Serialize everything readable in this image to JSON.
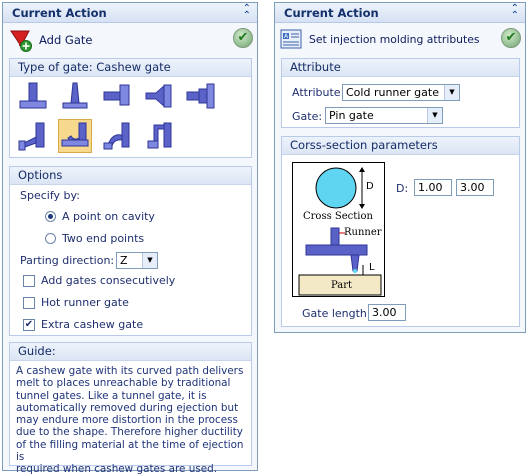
{
  "left_panel": {
    "title": "Current Action",
    "action_label": "Add Gate",
    "gate_type": {
      "heading": "Type of gate: Cashew gate",
      "buttons": [
        "direct-gate-icon",
        "pin-gate-icon",
        "side-gate-icon",
        "fan-gate-icon",
        "tab-gate-icon",
        "submarine-gate-icon",
        "cashew-gate-icon",
        "banana-gate-icon",
        "hook-gate-icon"
      ],
      "selected": "cashew-gate-icon"
    },
    "options": {
      "heading": "Options",
      "specify_by_label": "Specify by:",
      "radio_1": "A point on cavity",
      "radio_2": "Two end points",
      "selected_radio": "A point on cavity",
      "parting_label": "Parting direction:",
      "parting_value": "Z",
      "check_1": "Add gates consecutively",
      "check_2": "Hot runner gate",
      "check_3": "Extra cashew gate",
      "checked": [
        "Extra cashew gate"
      ]
    },
    "guide": {
      "heading": "Guide:",
      "lines": [
        "A cashew gate with its curved path delivers",
        "melt to places unreachable by traditional",
        "tunnel gates. Like a tunnel gate, it is",
        "automatically removed during ejection but",
        "may endure more distortion in the process",
        "due to the shape. Therefore higher ductility",
        "of the filling material at the time of ejection is",
        "required when cashew gates are used."
      ]
    }
  },
  "right_panel": {
    "title": "Current Action",
    "action_label": "Set injection molding attributes",
    "attribute": {
      "heading": "Attribute",
      "attr_label": "Attribute:",
      "attr_value": "Cold runner gate",
      "gate_label": "Gate:",
      "gate_value": "Pin gate"
    },
    "cross_section": {
      "heading": "Corss-section parameters",
      "diagram_d": "D",
      "diagram_cross": "Cross Section",
      "diagram_runner": "Runner",
      "diagram_l": "L",
      "diagram_part": "Part",
      "d_label": "D:",
      "d_value_1": "1.00",
      "d_value_2": "3.00",
      "gate_length_label": "Gate length:",
      "gate_length_value": "3.00"
    }
  },
  "colors": {
    "panel_border": "#7f9db9",
    "header_bg": "#dbe5f4",
    "title_text": "#14306d",
    "selected_gate": "#f6d98c",
    "gate_metal": "#5b63c9"
  }
}
